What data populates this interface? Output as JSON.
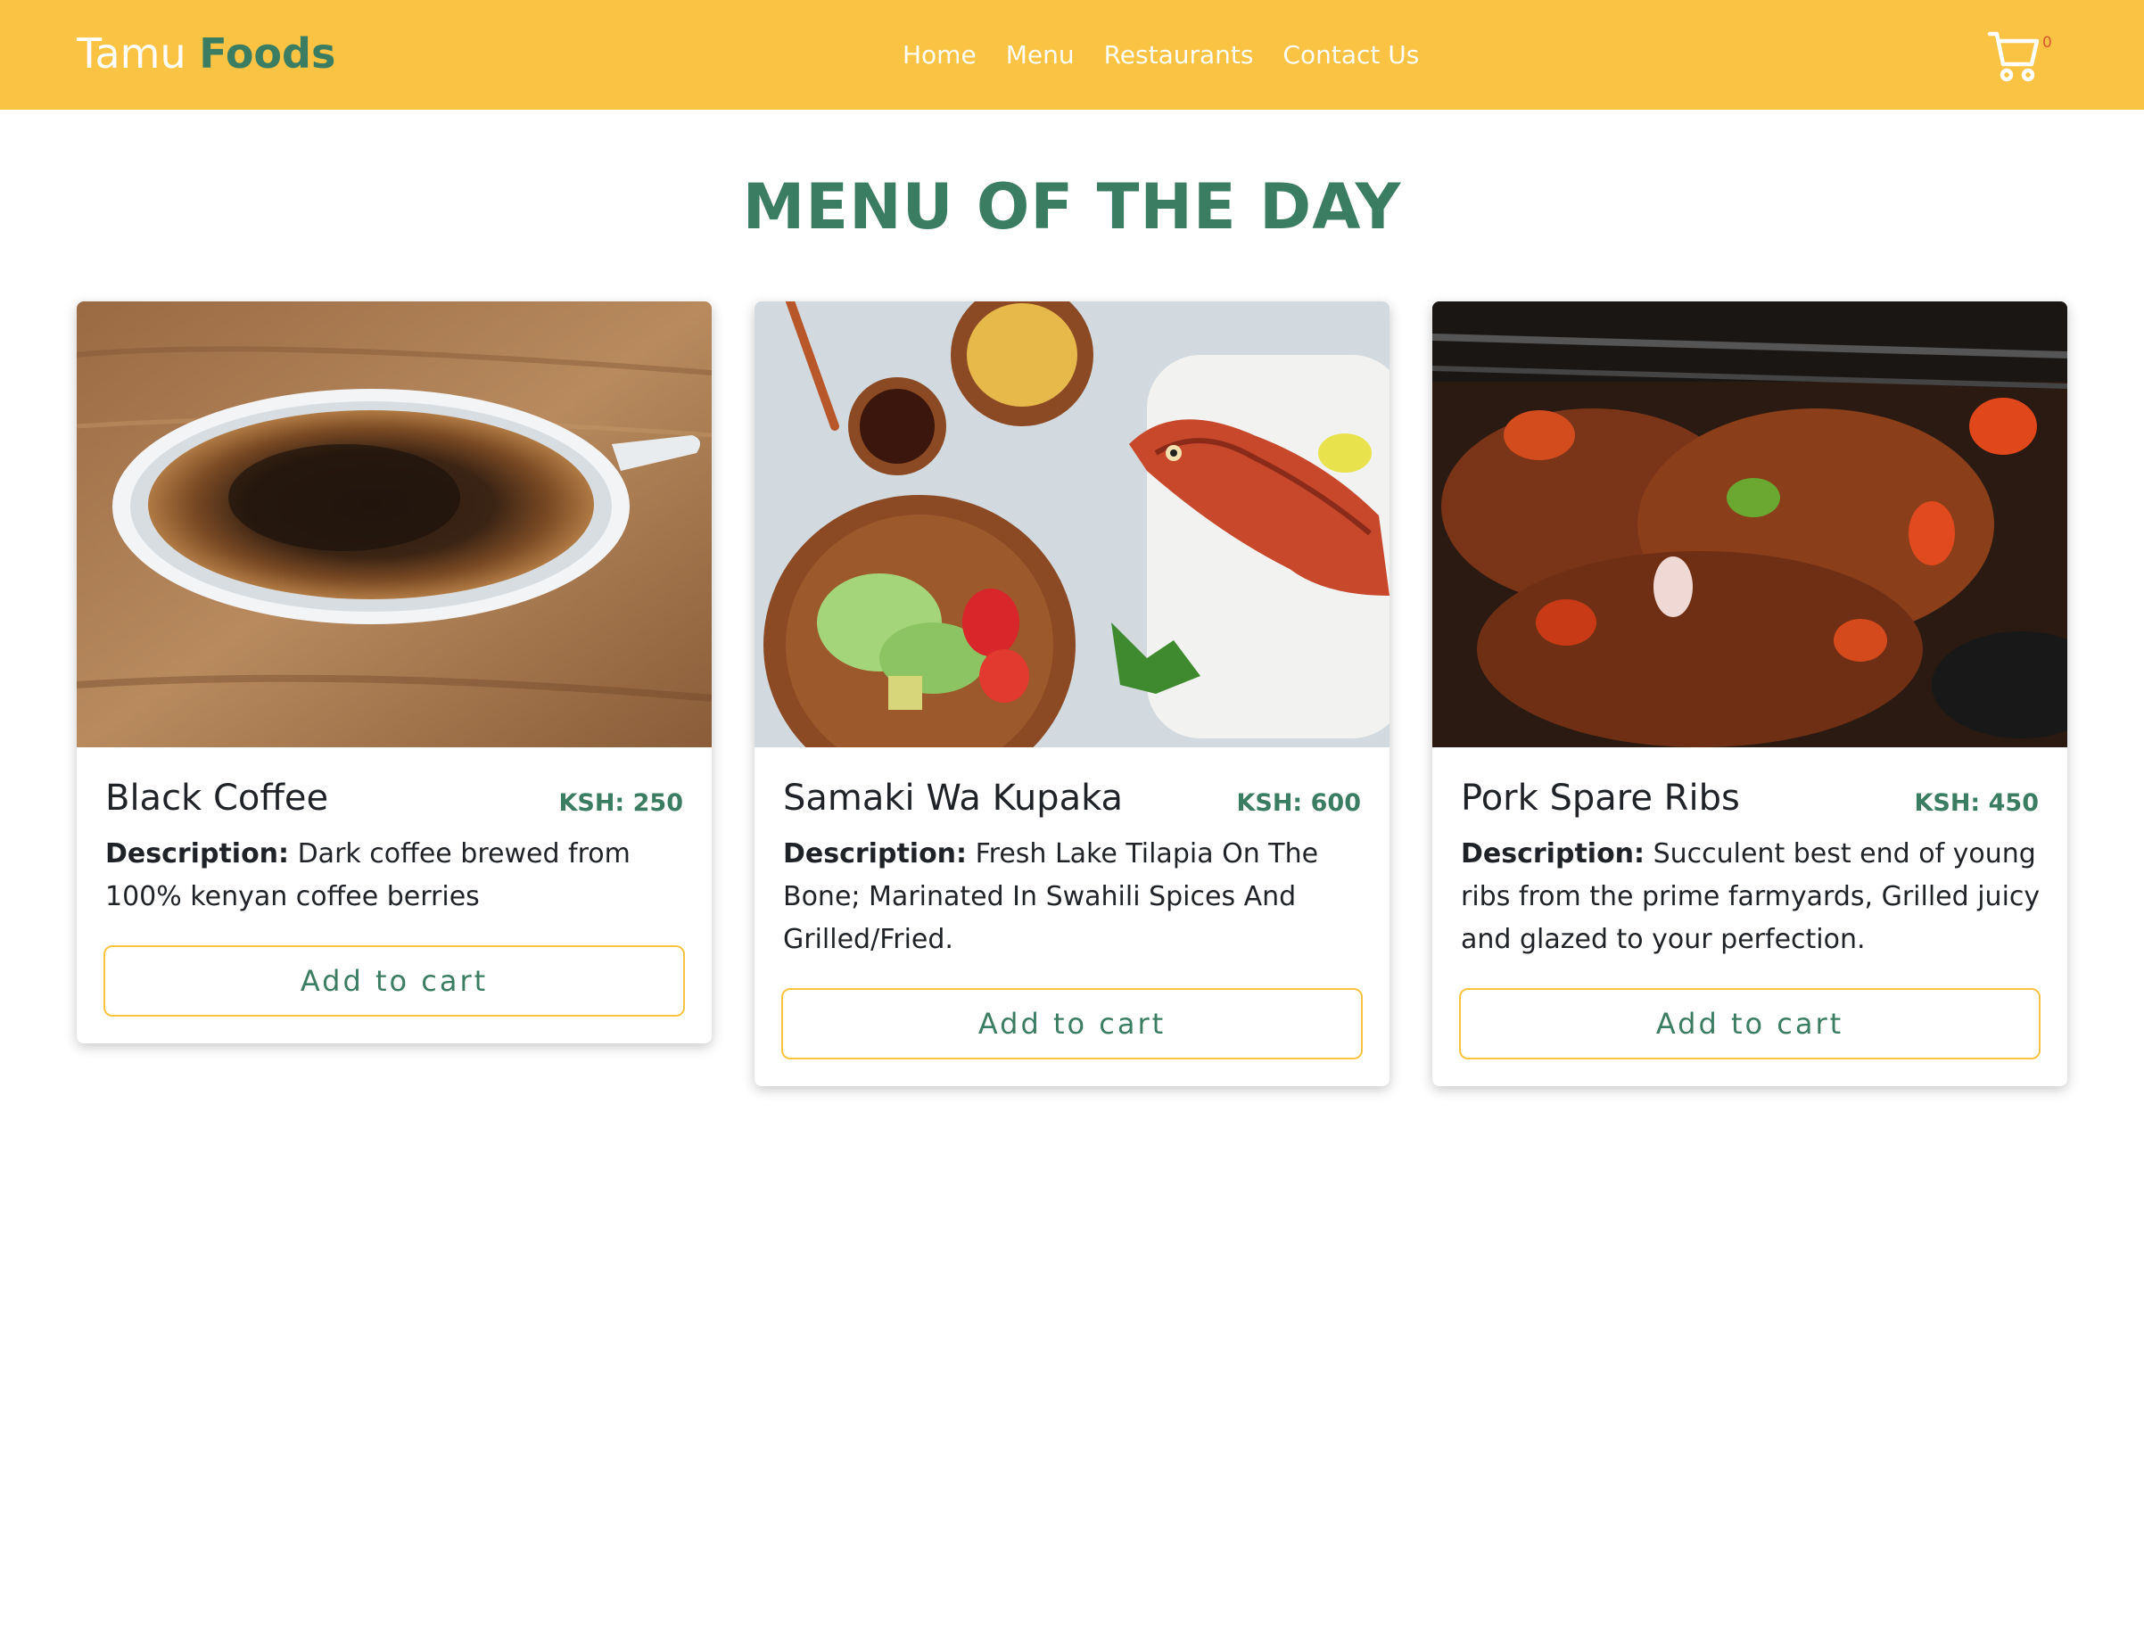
{
  "brand": {
    "first": "Tamu",
    "second": "Foods"
  },
  "nav": {
    "links": [
      "Home",
      "Menu",
      "Restaurants",
      "Contact Us"
    ]
  },
  "cart": {
    "icon": "shopping-cart-icon",
    "count": "0"
  },
  "main": {
    "title": "MENU OF THE DAY",
    "desc_label": "Description:",
    "add_to_cart": "Add to cart",
    "items": [
      {
        "name": "Black Coffee",
        "price": "KSH: 250",
        "description": "Dark coffee brewed from 100% kenyan coffee berries",
        "image": "black-coffee-photo"
      },
      {
        "name": "Samaki Wa Kupaka",
        "price": "KSH: 600",
        "description": "Fresh Lake Tilapia On The Bone; Marinated In Swahili Spices And Grilled/Fried.",
        "image": "fried-tilapia-photo"
      },
      {
        "name": "Pork Spare Ribs",
        "price": "KSH: 450",
        "description": "Succulent best end of young ribs from the prime farmyards, Grilled juicy and glazed to your perfection.",
        "image": "grilled-pork-ribs-photo"
      }
    ]
  },
  "colors": {
    "navbar": "#fbc344",
    "accent_green": "#3a7d62",
    "text_dark": "#1f2327",
    "cart_count": "#e05a2a"
  }
}
